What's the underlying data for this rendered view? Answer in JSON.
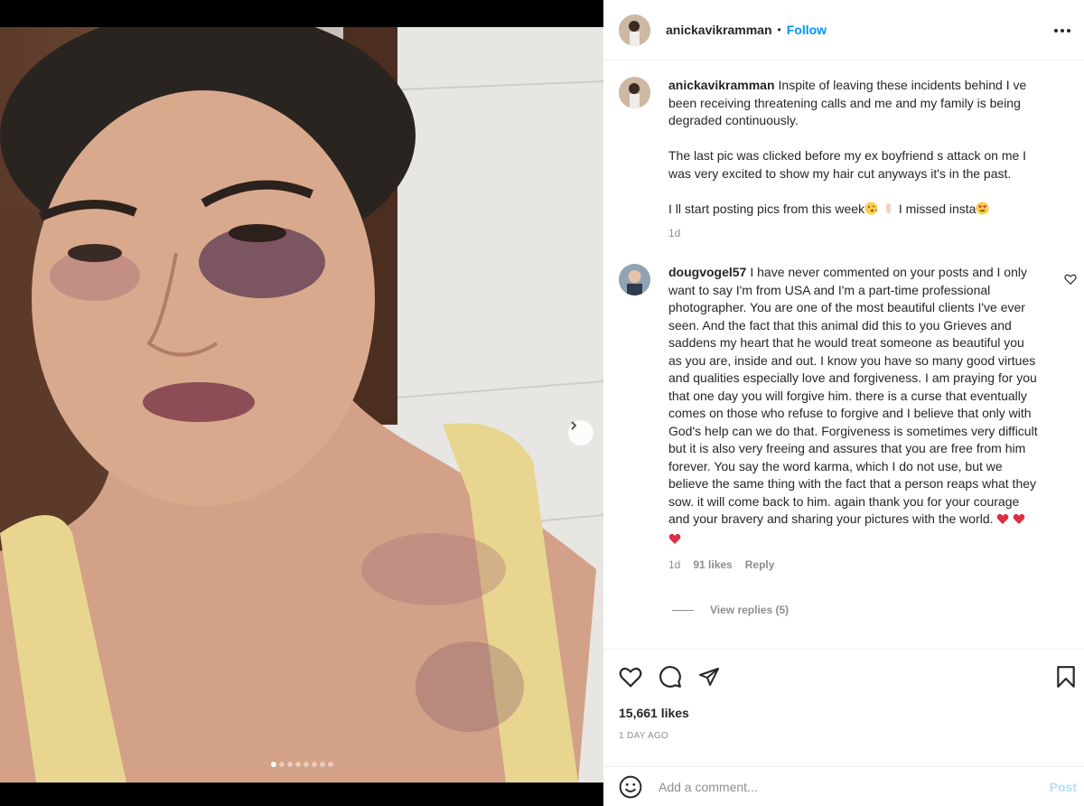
{
  "post": {
    "author": "anickavikramman",
    "separator": "•",
    "follow_label": "Follow",
    "media": {
      "slide_count": 8,
      "active_slide": 1
    }
  },
  "caption": {
    "username": "anickavikramman",
    "paragraph_1": "Inspite of leaving these incidents behind I ve been receiving threatening calls and me and my family is being degraded continuously.",
    "paragraph_2": "The last pic was clicked before my ex boyfriend s attack on me I was very excited to show my hair cut anyways it's in the past.",
    "paragraph_3_text_a": "I ll start posting pics from this week",
    "paragraph_3_text_b": "I missed insta",
    "age": "1d"
  },
  "comment": {
    "username": "dougvogel57",
    "text": "I have never commented on your posts and I only want to say I'm from USA and I'm a part-time professional photographer. You are one of the most beautiful clients I've ever seen. And the fact that this animal did this to you Grieves and saddens my heart that he would treat someone as beautiful you as you are, inside and out. I know you have so many good virtues and qualities especially love and forgiveness. I am praying for you that one day you will forgive him. there is a curse that eventually comes on those who refuse to forgive and I believe that only with God's help can we do that. Forgiveness is sometimes very difficult but it is also very freeing and assures that you are free from him forever. You say the word karma, which I do not use, but we believe the same thing with the fact that a person reaps what they sow. it will come back to him. again thank you for your courage and your bravery and sharing your pictures with the world.",
    "age": "1d",
    "likes": "91 likes",
    "reply_label": "Reply",
    "view_replies": "View replies (5)"
  },
  "footer": {
    "likes": "15,661 likes",
    "timestamp": "1 DAY AGO",
    "comment_placeholder": "Add a comment...",
    "post_label": "Post"
  },
  "icons": {
    "more": "more-horizontal-icon",
    "like": "heart-icon",
    "comment": "comment-bubble-icon",
    "share": "paper-plane-icon",
    "save": "bookmark-icon",
    "emoji": "smiley-icon",
    "next": "chevron-right-icon"
  },
  "colors": {
    "accent": "#0095f6",
    "post_disabled": "#b2dffc",
    "muted": "#8e8e8e",
    "heart_emoji": "#e0245e"
  }
}
